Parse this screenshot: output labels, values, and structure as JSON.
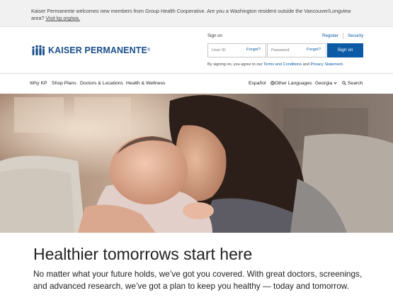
{
  "banner": {
    "text": "Kaiser Permanente welcomes new members from Group Health Cooperative. Are you a Washington resident outside the Vancouver/Longview area?",
    "link": "Visit kp.org/wa."
  },
  "header": {
    "logo_text": "KAISER PERMANENTE",
    "logo_mark": "®",
    "signin_label": "Sign on",
    "register_link": "Register",
    "security_link": "Security",
    "userid_placeholder": "User ID",
    "userid_forgot": "Forgot?",
    "password_placeholder": "Password",
    "password_forgot": "Forgot?",
    "signin_button": "Sign on",
    "terms_prefix": "By signing on, you agree to our",
    "terms_link": "Terms and Conditions",
    "terms_and": "and",
    "privacy_link": "Privacy Statement",
    "terms_suffix": "."
  },
  "nav": {
    "items": [
      "Why KP",
      "Shop Plans",
      "Doctors & Locations",
      "Health & Wellness"
    ],
    "espanol": "Español",
    "other_languages": "Other Languages",
    "region": "Georgia",
    "search": "Search"
  },
  "hero": {
    "image": "mother-kissing-baby-photo"
  },
  "main": {
    "headline": "Healthier tomorrows start here",
    "subtext": "No matter what your future holds, we’ve got you covered. With great doctors, screenings, and advanced research, we’ve got a plan to keep you healthy — today and tomorrow."
  },
  "colors": {
    "brand_blue": "#1a4f8b",
    "button_blue": "#0c5aa6",
    "link_blue": "#0b5aa2",
    "banner_bg": "#f1f1f1"
  }
}
